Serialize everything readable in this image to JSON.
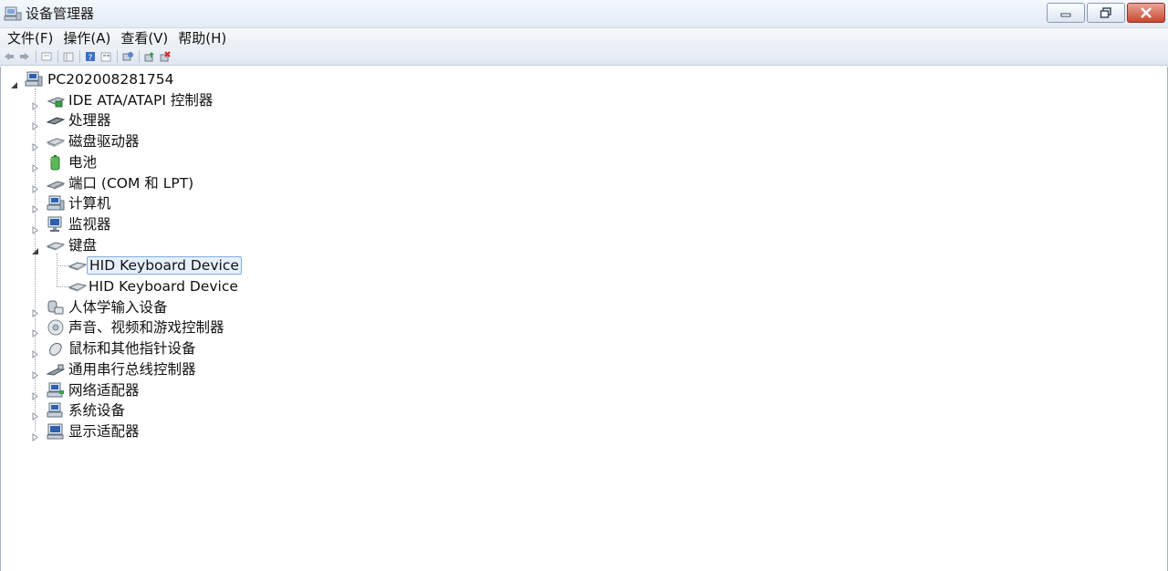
{
  "window": {
    "title": "设备管理器"
  },
  "menu": [
    {
      "label": "文件(F)"
    },
    {
      "label": "操作(A)"
    },
    {
      "label": "查看(V)"
    },
    {
      "label": "帮助(H)"
    }
  ],
  "toolbar": {
    "buttons": [
      "back-icon",
      "forward-icon",
      "properties-icon",
      "show-hide-tree-icon",
      "help-icon",
      "view-icon",
      "scan-hardware-icon",
      "update-driver-icon",
      "uninstall-icon"
    ]
  },
  "tree": {
    "root": {
      "label": "PC202008281754",
      "icon": "computer-icon",
      "expanded": true
    },
    "categories": [
      {
        "label": "IDE ATA/ATAPI 控制器",
        "icon": "ide-controller-icon",
        "expanded": false
      },
      {
        "label": "处理器",
        "icon": "processor-icon",
        "expanded": false
      },
      {
        "label": "磁盘驱动器",
        "icon": "disk-drive-icon",
        "expanded": false
      },
      {
        "label": "电池",
        "icon": "battery-icon",
        "expanded": false
      },
      {
        "label": "端口 (COM 和 LPT)",
        "icon": "port-icon",
        "expanded": false
      },
      {
        "label": "计算机",
        "icon": "computer-icon",
        "expanded": false
      },
      {
        "label": "监视器",
        "icon": "monitor-icon",
        "expanded": false
      },
      {
        "label": "键盘",
        "icon": "keyboard-icon",
        "expanded": true,
        "children": [
          {
            "label": "HID Keyboard Device",
            "icon": "keyboard-icon",
            "selected": true
          },
          {
            "label": "HID Keyboard Device",
            "icon": "keyboard-icon",
            "selected": false
          }
        ]
      },
      {
        "label": "人体学输入设备",
        "icon": "hid-icon",
        "expanded": false
      },
      {
        "label": "声音、视频和游戏控制器",
        "icon": "sound-icon",
        "expanded": false
      },
      {
        "label": "鼠标和其他指针设备",
        "icon": "mouse-icon",
        "expanded": false
      },
      {
        "label": "通用串行总线控制器",
        "icon": "usb-icon",
        "expanded": false
      },
      {
        "label": "网络适配器",
        "icon": "network-adapter-icon",
        "expanded": false
      },
      {
        "label": "系统设备",
        "icon": "system-device-icon",
        "expanded": false
      },
      {
        "label": "显示适配器",
        "icon": "display-adapter-icon",
        "expanded": false
      }
    ]
  },
  "colors": {
    "selection_fill": "#e6f0fb",
    "selection_border": "#84acdd",
    "close_button": "#c9482f"
  }
}
